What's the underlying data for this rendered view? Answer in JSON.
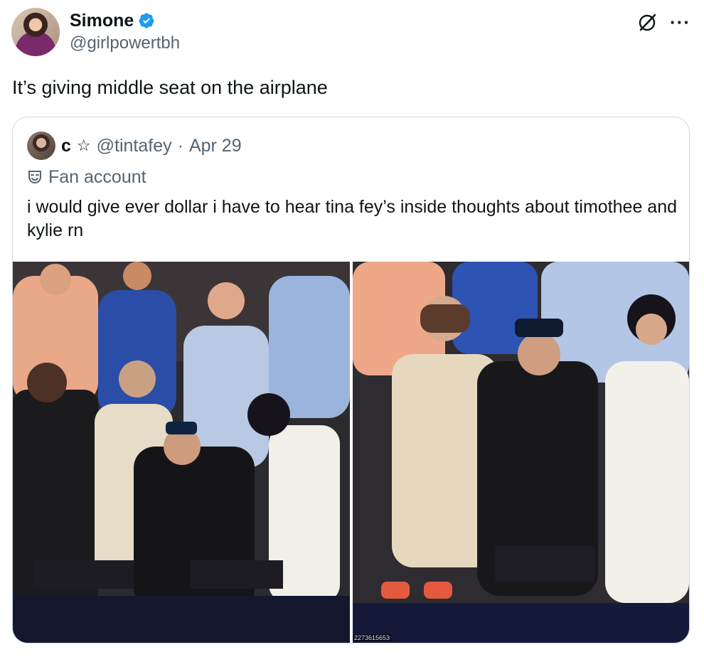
{
  "tweet": {
    "author_name": "Simone",
    "author_handle": "@girlpowertbh",
    "text": "It’s giving middle seat on the airplane"
  },
  "icons": {
    "verified": "verified-badge-icon",
    "grok": "grok-icon",
    "more": "more-options-icon",
    "mask": "mask-icon"
  },
  "quoted": {
    "author_name": "c",
    "star": "☆",
    "author_handle": "@tintafey",
    "separator": "·",
    "date": "Apr 29",
    "label": "Fan account",
    "text": "i would give ever dollar i have to hear tina fey’s inside thoughts about timothee and kylie rn",
    "photo_id": "2273615653"
  },
  "colors": {
    "verified_blue": "#1d9bf0",
    "secondary_text": "#536471",
    "border": "#cfd9de"
  }
}
